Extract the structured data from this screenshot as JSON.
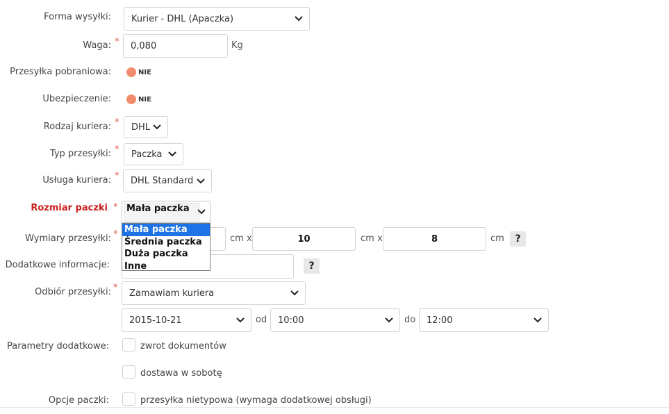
{
  "labels": {
    "shipping_form": "Forma wysyłki:",
    "weight": "Waga:",
    "cod": "Przesyłka pobraniowa:",
    "insurance": "Ubezpieczenie:",
    "courier_type": "Rodzaj kuriera:",
    "shipment_type": "Typ przesyłki:",
    "courier_service": "Usługa kuriera:",
    "package_size": "Rozmiar paczki",
    "dimensions": "Wymiary przesyłki:",
    "extra_info": "Dodatkowe informacje:",
    "pickup": "Odbiór przesyłki:",
    "extra_params": "Parametry dodatkowe:",
    "package_options": "Opcje paczki:"
  },
  "required_mark": "*",
  "shipping_form": {
    "value": "Kurier - DHL (Apaczka)"
  },
  "weight": {
    "value": "0,080",
    "unit": "Kg"
  },
  "cod": {
    "state": "NIE"
  },
  "insurance": {
    "state": "NIE"
  },
  "courier_type": {
    "value": "DHL"
  },
  "shipment_type": {
    "value": "Paczka"
  },
  "courier_service": {
    "value": "DHL Standard"
  },
  "package_size": {
    "value": "Mała paczka",
    "options": [
      "Mała paczka",
      "Średnia paczka",
      "Duża paczka",
      "Inne"
    ],
    "highlighted_index": 0
  },
  "dimensions": {
    "length": "",
    "width": "10",
    "height": "8",
    "unit_x": "cm x",
    "unit": "cm",
    "help": "?"
  },
  "extra_info": {
    "value": "",
    "help": "?"
  },
  "pickup": {
    "method": "Zamawiam kuriera",
    "date": "2015-10-21",
    "from_label": "od",
    "from_time": "10:00",
    "to_label": "do",
    "to_time": "12:00"
  },
  "extra_params": {
    "return_docs": "zwrot dokumentów",
    "saturday_delivery": "dostawa w sobotę"
  },
  "package_options": {
    "nonstandard": "przesyłka nietypowa (wymaga dodatkowej obsługi)"
  },
  "colors": {
    "label_error": "#cc1f1f",
    "required": "#e05a4a",
    "toggle_off": "#f28c6e",
    "option_highlight": "#1e74e6"
  },
  "icons": {
    "select_arrow": "chevron-down-icon"
  }
}
